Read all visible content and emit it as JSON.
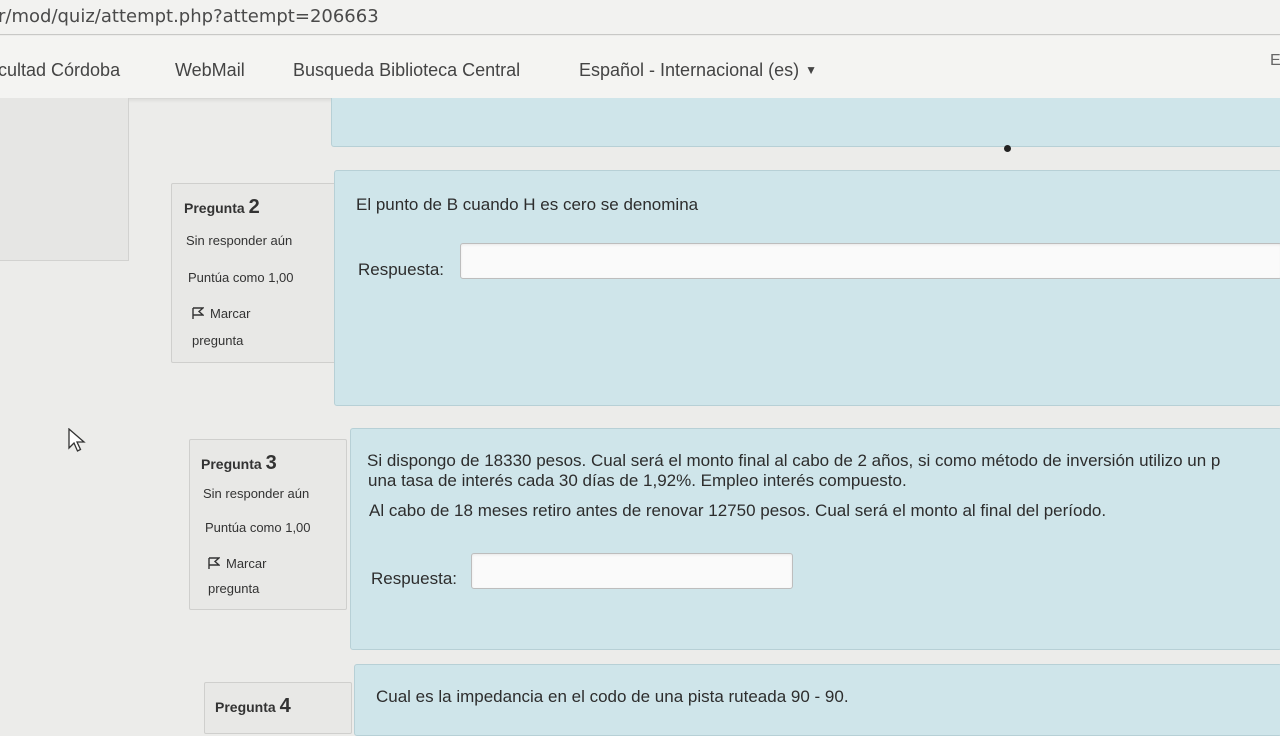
{
  "browser": {
    "url": "r/mod/quiz/attempt.php?attempt=206663"
  },
  "nav": {
    "items": [
      "cultad Córdoba",
      "WebMail",
      "Busqueda Biblioteca Central"
    ],
    "language": "Español - Internacional (es)",
    "edge_text": "E"
  },
  "questions": [
    {
      "label": "Pregunta",
      "number": "2",
      "status": "Sin responder aún",
      "score": "Puntúa como 1,00",
      "flag_label_1": "Marcar",
      "flag_label_2": "pregunta",
      "text": [
        "El punto de B cuando H es cero se denomina"
      ],
      "answer_label": "Respuesta:",
      "answer_value": ""
    },
    {
      "label": "Pregunta",
      "number": "3",
      "status": "Sin responder aún",
      "score": "Puntúa como 1,00",
      "flag_label_1": "Marcar",
      "flag_label_2": "pregunta",
      "text": [
        "Si dispongo de 18330 pesos. Cual será el monto final al cabo de 2 años, si como método de inversión utilizo un p",
        "una tasa de interés cada 30 días de 1,92%. Empleo interés compuesto.",
        "Al cabo de 18 meses retiro antes de renovar 12750 pesos. Cual será el monto al final del período."
      ],
      "answer_label": "Respuesta:",
      "answer_value": ""
    },
    {
      "label": "Pregunta",
      "number": "4",
      "text": [
        "Cual es la impedancia en el codo de una pista ruteada 90 - 90."
      ]
    }
  ],
  "colors": {
    "question_bg": "#cfe5ea",
    "info_bg": "#e8e8e6",
    "page_bg": "#ececea"
  },
  "icons": {
    "flag": "flag-icon",
    "cursor": "mouse-pointer-icon"
  }
}
